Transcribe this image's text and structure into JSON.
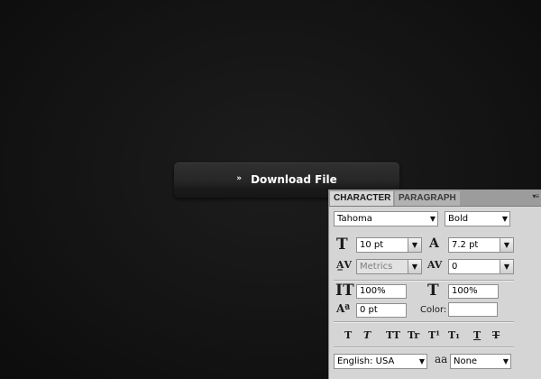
{
  "download_button": {
    "label": "Download File",
    "icon": "double-chevron-down-icon"
  },
  "panel": {
    "tabs": [
      {
        "label": "CHARACTER",
        "active": true
      },
      {
        "label": "PARAGRAPH",
        "active": false
      }
    ],
    "menu_icon": "panel-menu-icon",
    "font_family": "Tahoma",
    "font_style": "Bold",
    "font_size": "10 pt",
    "leading": "7.2 pt",
    "kerning": "Metrics",
    "tracking": "0",
    "vertical_scale": "100%",
    "horizontal_scale": "100%",
    "baseline_shift": "0 pt",
    "color_label": "Color:",
    "color_value": "#ffffff",
    "language": "English: USA",
    "antialias_label": "aa",
    "antialias": "None",
    "style_buttons": [
      "T",
      "T",
      "TT",
      "Tr",
      "T¹",
      "T₁",
      "T",
      "T"
    ]
  }
}
